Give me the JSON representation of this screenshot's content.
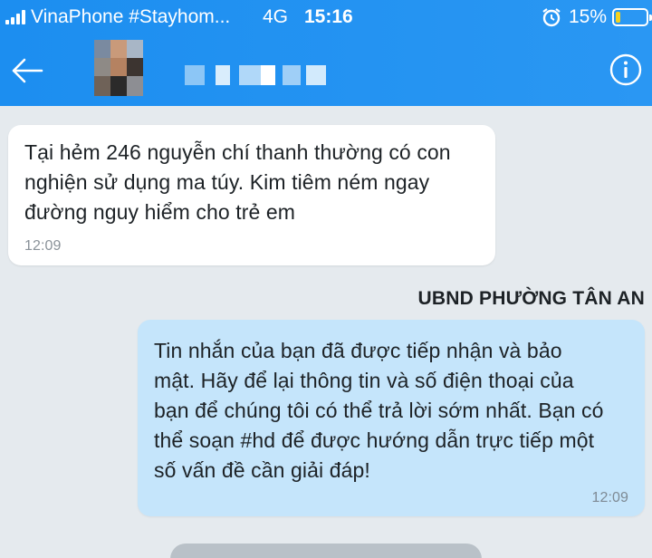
{
  "status_bar": {
    "carrier": "VinaPhone #Stayhom...",
    "network": "4G",
    "time": "15:16",
    "battery_percent": "15%",
    "battery_level": 0.15
  },
  "header": {
    "back_icon": "arrow-left-icon",
    "info_icon": "info-circle-icon",
    "colors": {
      "background": "#2091f1"
    }
  },
  "messages": [
    {
      "direction": "incoming",
      "lines": [
        "Tại hẻm 246 nguyễn chí thanh thường có con",
        "nghiện sử dụng ma túy. Kim tiêm ném ngay",
        "đường nguy hiểm cho trẻ em"
      ],
      "time": "12:09"
    },
    {
      "direction": "outgoing",
      "sender": "UBND PHƯỜNG TÂN AN",
      "lines": [
        "Tin nhắn của bạn đã được tiếp nhận và bảo",
        "mật. Hãy để lại thông tin và số điện thoại của",
        "bạn để chúng tôi có thể trả lời sớm nhất. Bạn có",
        "thể soạn #hd để được hướng dẫn trực tiếp một",
        "số vấn đề cần giải đáp!"
      ],
      "time": "12:09"
    }
  ],
  "colors": {
    "chat_background": "#e5eaee",
    "incoming_bubble": "#ffffff",
    "outgoing_bubble": "#c5e5fb"
  }
}
